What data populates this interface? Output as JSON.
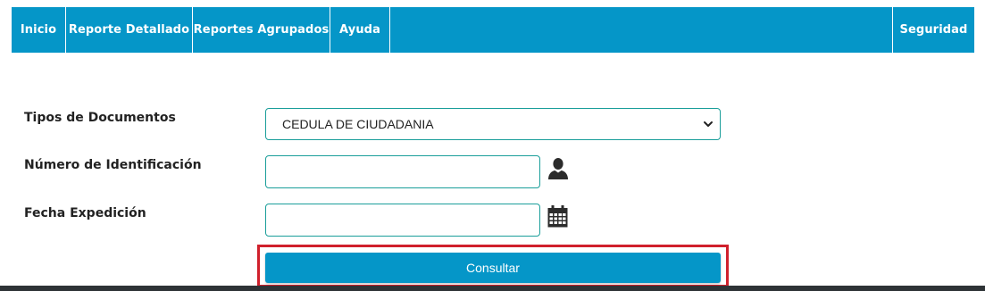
{
  "nav": {
    "items": [
      {
        "label": "Inicio"
      },
      {
        "label": "Reporte Detallado"
      },
      {
        "label": "Reportes Agrupados"
      },
      {
        "label": "Ayuda"
      }
    ],
    "right_item": {
      "label": "Seguridad"
    }
  },
  "form": {
    "doc_type_label": "Tipos de Documentos",
    "doc_type_value": "CEDULA DE CIUDADANIA",
    "id_number_label": "Número de Identificación",
    "id_number_value": "",
    "expedition_date_label": "Fecha Expedición",
    "expedition_date_value": "",
    "submit_label": "Consultar"
  },
  "icons": {
    "id_field_icon": "user-icon",
    "date_field_icon": "calendar-icon",
    "select_icon": "chevron-down-icon"
  },
  "colors": {
    "nav_bg": "#0596c8",
    "button_bg": "#0596c8",
    "input_border": "#1a9e9a",
    "highlight_frame": "#d0202c",
    "footer": "#2e3336"
  }
}
